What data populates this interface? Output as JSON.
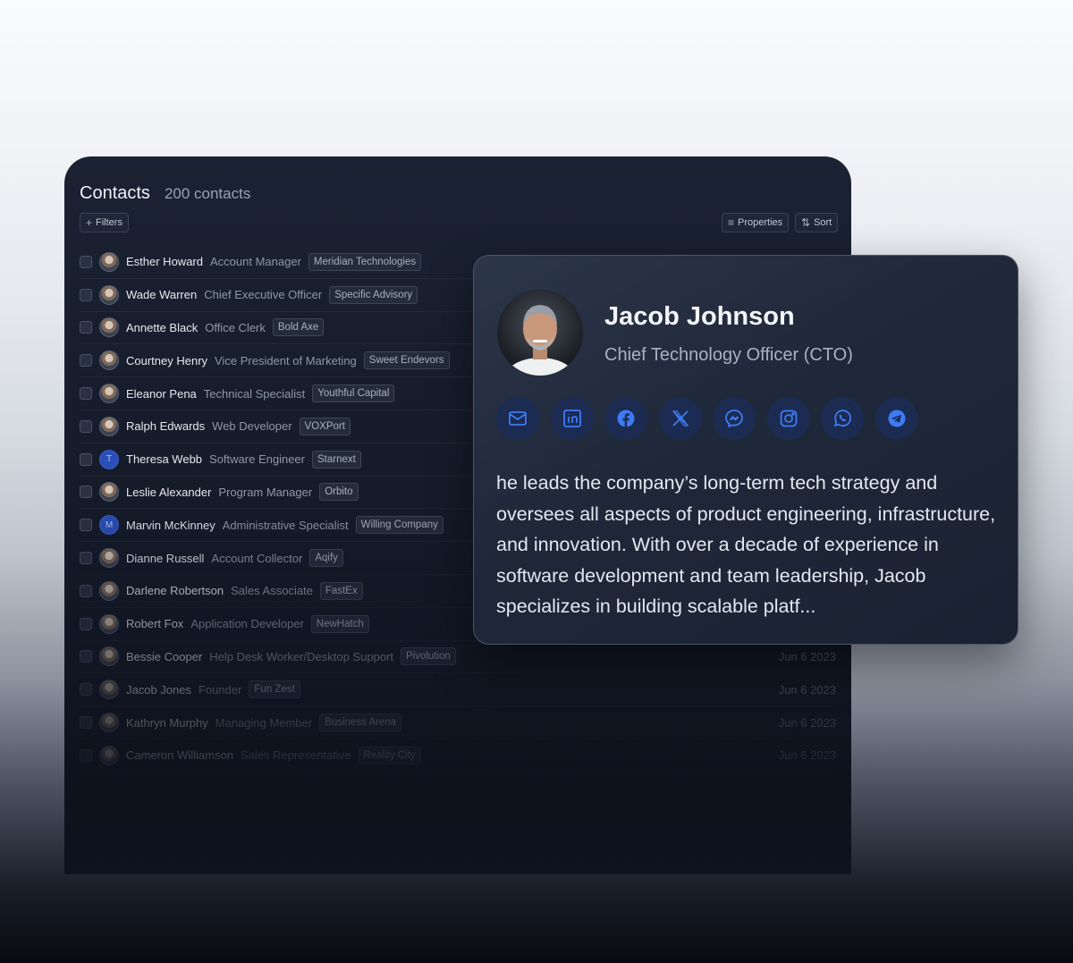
{
  "header": {
    "title": "Contacts",
    "count": "200 contacts"
  },
  "toolbar": {
    "filters": "Filters",
    "properties": "Properties",
    "sort": "Sort"
  },
  "contacts": [
    {
      "name": "Esther Howard",
      "title": "Account Manager",
      "company": "Meridian Technologies",
      "date": ""
    },
    {
      "name": "Wade Warren",
      "title": "Chief Executive Officer",
      "company": "Specific Advisory",
      "date": ""
    },
    {
      "name": "Annette Black",
      "title": "Office Clerk",
      "company": "Bold Axe",
      "date": ""
    },
    {
      "name": "Courtney Henry",
      "title": "Vice President of Marketing",
      "company": "Sweet Endevors",
      "date": ""
    },
    {
      "name": "Eleanor Pena",
      "title": "Technical Specialist",
      "company": "Youthful Capital",
      "date": ""
    },
    {
      "name": "Ralph Edwards",
      "title": "Web Developer",
      "company": "VOXPort",
      "date": ""
    },
    {
      "name": "Theresa Webb",
      "title": "Software Engineer",
      "company": "Starnext",
      "date": "",
      "initial": "T"
    },
    {
      "name": "Leslie Alexander",
      "title": "Program Manager",
      "company": "Orbito",
      "date": ""
    },
    {
      "name": "Marvin McKinney",
      "title": "Administrative Specialist",
      "company": "Willing Company",
      "date": "",
      "initial": "M"
    },
    {
      "name": "Dianne Russell",
      "title": "Account Collector",
      "company": "Aqify",
      "date": ""
    },
    {
      "name": "Darlene Robertson",
      "title": "Sales Associate",
      "company": "FastEx",
      "date": ""
    },
    {
      "name": "Robert Fox",
      "title": "Application Developer",
      "company": "NewHatch",
      "date": ""
    },
    {
      "name": "Bessie Cooper",
      "title": "Help Desk Worker/Desktop Support",
      "company": "Pivolution",
      "date": "Jun 6 2023"
    },
    {
      "name": "Jacob Jones",
      "title": "Founder",
      "company": "Fun Zest",
      "date": "Jun 6 2023"
    },
    {
      "name": "Kathryn Murphy",
      "title": "Managing Member",
      "company": "Business Arena",
      "date": "Jun 6 2023"
    },
    {
      "name": "Cameron Williamson",
      "title": "Sales Representative",
      "company": "Reality City",
      "date": "Jun 6 2023"
    }
  ],
  "profile": {
    "name": "Jacob Johnson",
    "role": "Chief Technology Officer (CTO)",
    "bio": "he leads the company’s long-term tech strategy and oversees all aspects of product engineering, infrastructure, and innovation. With over a decade of experience in software development and team leadership, Jacob specializes in building scalable platf...",
    "socials": [
      "email-icon",
      "linkedin-icon",
      "facebook-icon",
      "x-icon",
      "messenger-icon",
      "instagram-icon",
      "whatsapp-icon",
      "telegram-icon"
    ],
    "icon_color": "#3d7bf5"
  }
}
